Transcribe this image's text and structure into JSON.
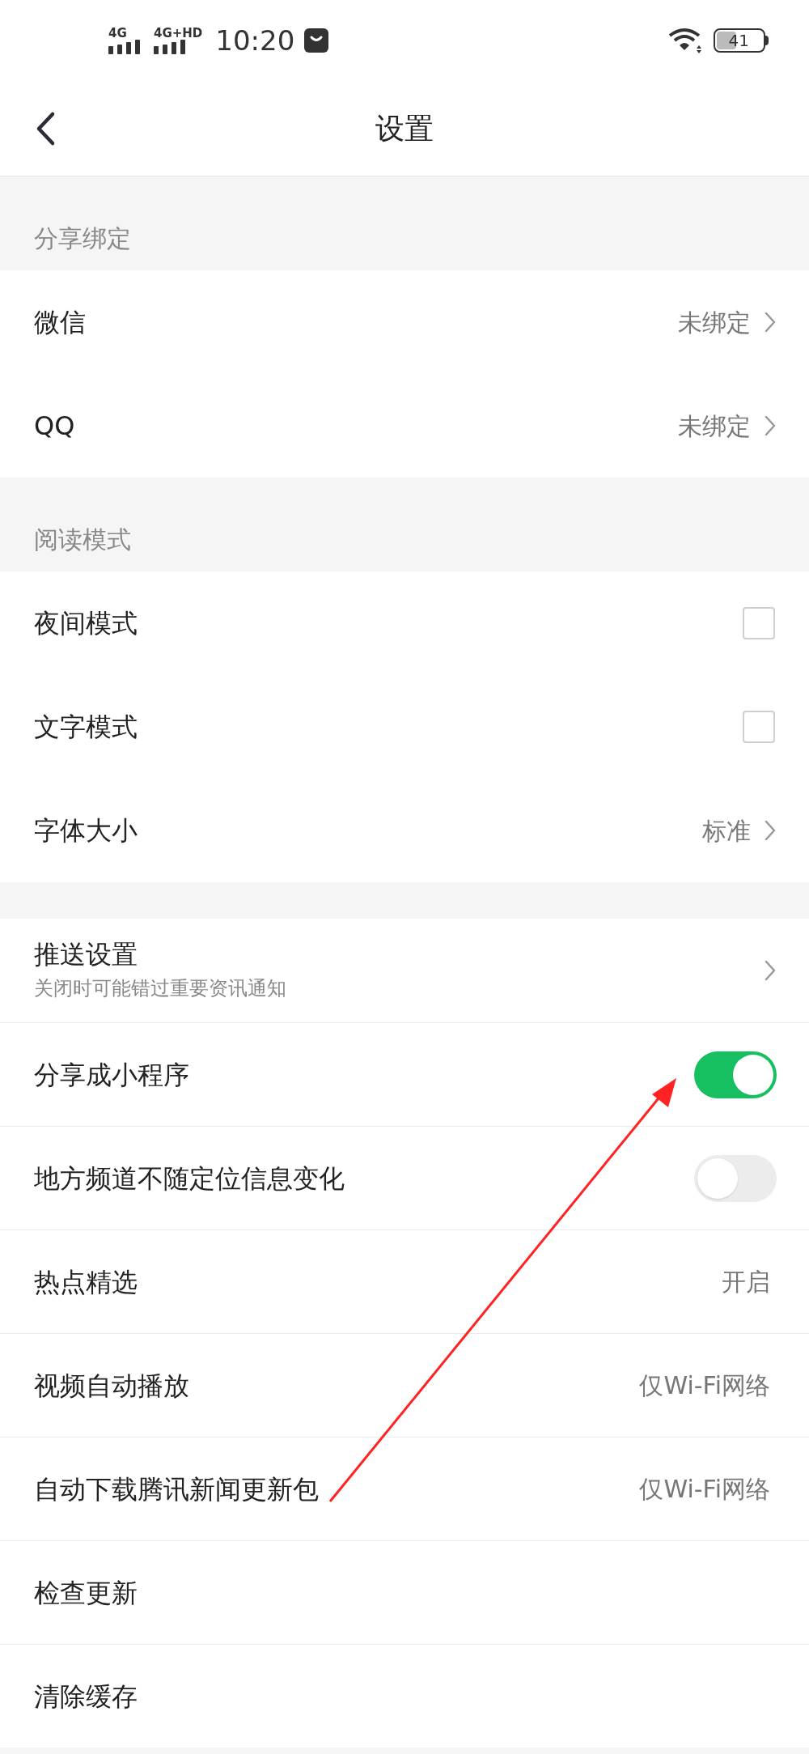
{
  "status_bar": {
    "network_1": "4G",
    "network_2": "4G+HD",
    "time": "10:20",
    "battery": "41"
  },
  "header": {
    "title": "设置"
  },
  "sections": [
    {
      "title": "分享绑定",
      "items": [
        {
          "kind": "link",
          "label": "微信",
          "value": "未绑定"
        },
        {
          "kind": "link",
          "label": "QQ",
          "value": "未绑定"
        }
      ]
    },
    {
      "title": "阅读模式",
      "items": [
        {
          "kind": "checkbox",
          "label": "夜间模式",
          "checked": false
        },
        {
          "kind": "checkbox",
          "label": "文字模式",
          "checked": false
        },
        {
          "kind": "link",
          "label": "字体大小",
          "value": "标准"
        }
      ]
    },
    {
      "items": [
        {
          "kind": "link",
          "label": "推送设置",
          "subtitle": "关闭时可能错过重要资讯通知"
        },
        {
          "kind": "toggle",
          "label": "分享成小程序",
          "on": true
        },
        {
          "kind": "toggle",
          "label": "地方频道不随定位信息变化",
          "on": false
        },
        {
          "kind": "value",
          "label": "热点精选",
          "value": "开启"
        },
        {
          "kind": "value",
          "label": "视频自动播放",
          "value": "仅Wi-Fi网络"
        },
        {
          "kind": "value",
          "label": "自动下载腾讯新闻更新包",
          "value": "仅Wi-Fi网络"
        },
        {
          "kind": "plain",
          "label": "检查更新"
        },
        {
          "kind": "plain",
          "label": "清除缓存"
        }
      ]
    }
  ]
}
